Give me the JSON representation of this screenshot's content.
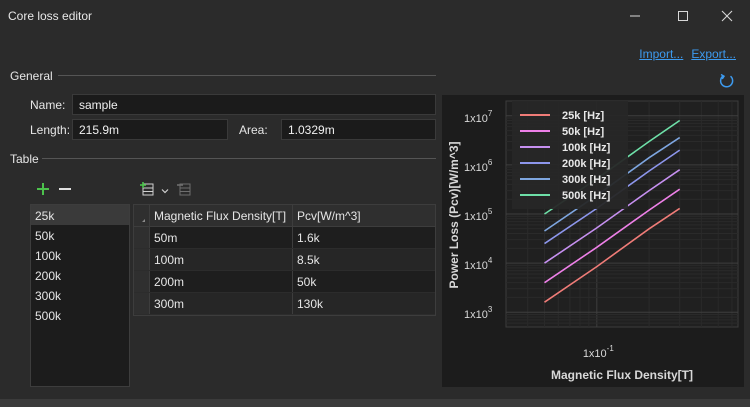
{
  "window": {
    "title": "Core loss editor"
  },
  "toolbar": {
    "import_label": "Import...",
    "export_label": "Export..."
  },
  "general": {
    "heading": "General",
    "name_label": "Name:",
    "name_value": "sample",
    "length_label": "Length:",
    "length_value": "215.9m",
    "area_label": "Area:",
    "area_value": "1.0329m"
  },
  "table": {
    "heading": "Table",
    "frequencies": [
      "25k",
      "50k",
      "100k",
      "200k",
      "300k",
      "500k"
    ],
    "selected_frequency": "25k",
    "columns": [
      "Magnetic Flux Density[T]",
      "Pcv[W/m^3]"
    ],
    "rows": [
      [
        "50m",
        "1.6k"
      ],
      [
        "100m",
        "8.5k"
      ],
      [
        "200m",
        "50k"
      ],
      [
        "300m",
        "130k"
      ]
    ]
  },
  "icons": [
    "window-close-icon",
    "window-maximize-icon",
    "window-minimize-icon",
    "refresh-icon",
    "add-icon",
    "remove-icon",
    "add-row-icon",
    "delete-row-icon",
    "chevron-down-icon"
  ],
  "chart_data": {
    "type": "line",
    "xlabel": "Magnetic Flux Density[T]",
    "ylabel": "Power Loss (Pcv)[W/m^3]",
    "x_scale": "log",
    "y_scale": "log",
    "ylim": [
      500,
      20000000
    ],
    "y_ticks": [
      "1x10^3",
      "1x10^4",
      "1x10^5",
      "1x10^6",
      "1x10^7"
    ],
    "x_ticks": [
      "1x10^-1"
    ],
    "grid": true,
    "legend_position": "top-left",
    "series": [
      {
        "name": "25k [Hz]",
        "color": "#f07c78",
        "x": [
          0.05,
          0.1,
          0.2,
          0.3
        ],
        "y": [
          1600,
          8500,
          50000,
          130000
        ]
      },
      {
        "name": "50k [Hz]",
        "color": "#ee80e8",
        "x": [
          0.05,
          0.1,
          0.2,
          0.3
        ],
        "y": [
          4000,
          21000,
          120000,
          320000
        ]
      },
      {
        "name": "100k [Hz]",
        "color": "#c690f0",
        "x": [
          0.05,
          0.1,
          0.2,
          0.3
        ],
        "y": [
          10000,
          52000,
          300000,
          800000
        ]
      },
      {
        "name": "200k [Hz]",
        "color": "#8d96ec",
        "x": [
          0.05,
          0.1,
          0.2,
          0.3
        ],
        "y": [
          25000,
          130000,
          750000,
          2000000
        ]
      },
      {
        "name": "300k [Hz]",
        "color": "#7ea6e0",
        "x": [
          0.05,
          0.1,
          0.2,
          0.3
        ],
        "y": [
          45000,
          240000,
          1400000,
          3600000
        ]
      },
      {
        "name": "500k [Hz]",
        "color": "#6ee0a8",
        "x": [
          0.05,
          0.1,
          0.2,
          0.3
        ],
        "y": [
          100000,
          520000,
          3000000,
          8000000
        ]
      }
    ]
  }
}
